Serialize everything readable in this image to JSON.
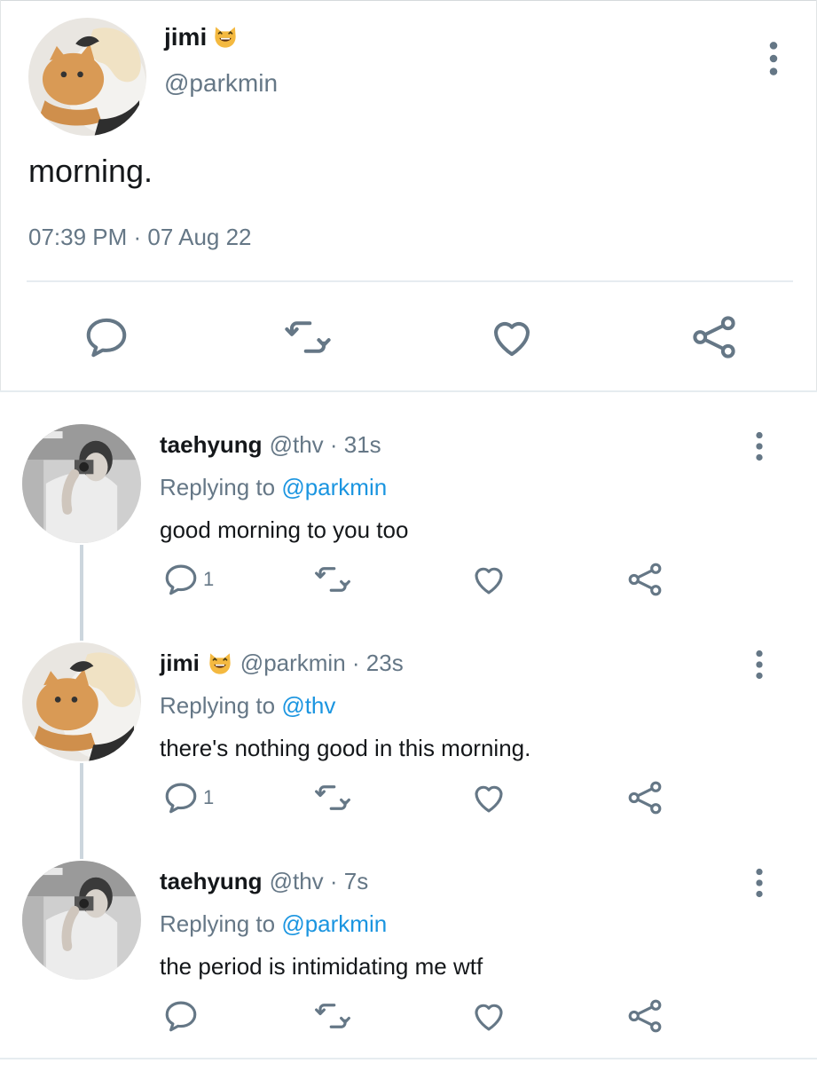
{
  "main_tweet": {
    "name": "jimi",
    "name_emoji": "grinning-cat-emoji",
    "handle": "@parkmin",
    "text": "morning.",
    "time": "07:39 PM",
    "separator": " · ",
    "date": "07 Aug 22",
    "actions": [
      "reply-icon",
      "retweet-icon",
      "like-icon",
      "share-icon"
    ]
  },
  "replies": [
    {
      "name": "taehyung",
      "handle": "@thv",
      "meta_sep": " · ",
      "age": "31s",
      "replying_prefix": "Replying to ",
      "replying_to": "@parkmin",
      "text": "good morning to you too",
      "reply_count": "1"
    },
    {
      "name": "jimi",
      "name_emoji": "grinning-cat-emoji",
      "handle": "@parkmin",
      "meta_sep": " · ",
      "age": "23s",
      "replying_prefix": "Replying to ",
      "replying_to": "@thv",
      "text": "there's nothing good in this morning.",
      "reply_count": "1"
    },
    {
      "name": "taehyung",
      "handle": "@thv",
      "meta_sep": " · ",
      "age": "7s",
      "replying_prefix": "Replying to ",
      "replying_to": "@parkmin",
      "text": "the period is intimidating me wtf",
      "reply_count": ""
    }
  ],
  "colors": {
    "text_primary": "#14171a",
    "text_secondary": "#657786",
    "mention_blue": "#1b95e0",
    "icon_gray": "#657786",
    "divider": "#e6ecf0"
  }
}
